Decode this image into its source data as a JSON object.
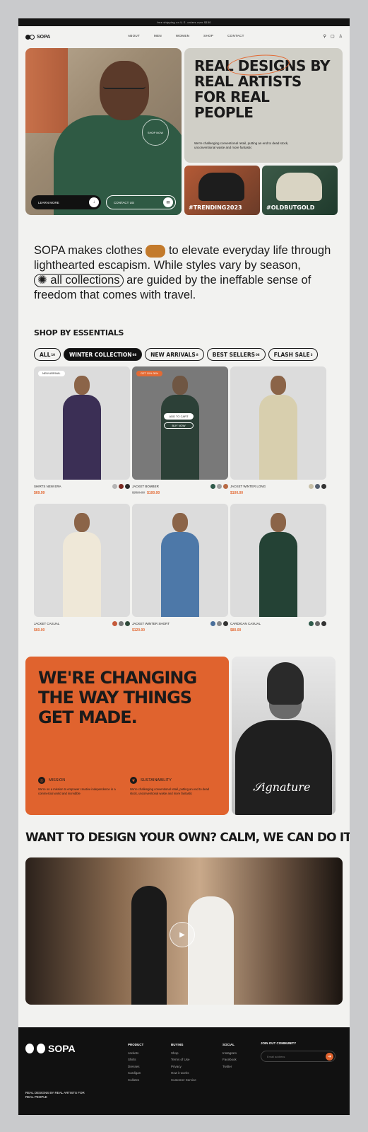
{
  "announcement": "free shipping on U.S. orders over $150",
  "brand": "SOPA",
  "nav": {
    "items": [
      "ABOUT",
      "MEN",
      "WOMEN",
      "SHOP",
      "CONTACT"
    ]
  },
  "hero": {
    "headline": "REAL DESIGNS BY REAL ARTISTS FOR REAL PEOPLE",
    "description": "We're challenging conventional retail, putting an end to dead stock, unconventional waste and more fantastic",
    "shop_now": "SHOP NOW",
    "learn_more": "LEARN MORE",
    "contact_us": "CONTACT US",
    "tiles": [
      "#TRENDING2023",
      "#OLDBUTGOLD"
    ]
  },
  "intro": {
    "part1": "SOPA makes clothes",
    "part2": "to elevate everyday life through lighthearted escapism. While styles vary by season,",
    "collections_pill": "all collections",
    "part3": "are guided by the ineffable sense of freedom that comes with travel."
  },
  "essentials": {
    "title": "SHOP BY ESSENTIALS",
    "filters": [
      {
        "label": "ALL",
        "count": "10"
      },
      {
        "label": "WINTER COLLECTION",
        "count": "08"
      },
      {
        "label": "NEW ARRIVALS",
        "count": "8"
      },
      {
        "label": "BEST SELLERS",
        "count": "06"
      },
      {
        "label": "FLASH SALE",
        "count": "3"
      }
    ],
    "products": [
      {
        "name": "SHIRTS NEW ERA",
        "price": "$69.99",
        "old_price": "",
        "tag": "NEW ARRIVAL",
        "colors": [
          "#b5b5b5",
          "#7a2a22",
          "#2b2b2b"
        ]
      },
      {
        "name": "JACKET BOMBER",
        "price": "$100.00",
        "old_price": "$250.00",
        "tag": "GET 10% 30%",
        "colors": [
          "#2f5a4a",
          "#a0a0a0",
          "#b86a45"
        ],
        "add_to_cart": "ADD TO CART",
        "buy_now": "BUY NOW"
      },
      {
        "name": "JACKET WINTER LONG",
        "price": "$100.00",
        "old_price": "",
        "tag": "",
        "colors": [
          "#c9c1a8",
          "#556070",
          "#333333"
        ]
      },
      {
        "name": "JACKET CASUAL",
        "price": "$60.00",
        "old_price": "",
        "tag": "",
        "colors": [
          "#c55a3a",
          "#777777",
          "#2f4a3a"
        ]
      },
      {
        "name": "JACKET WINTER SHORT",
        "price": "$120.00",
        "old_price": "",
        "tag": "",
        "colors": [
          "#4a6f9a",
          "#888888",
          "#333333"
        ]
      },
      {
        "name": "CARDIGAN CASUAL",
        "price": "$80.00",
        "old_price": "",
        "tag": "",
        "colors": [
          "#2f5a4a",
          "#666666",
          "#333333"
        ]
      }
    ]
  },
  "change": {
    "headline": "WE'RE CHANGING THE WAY THINGS GET MADE.",
    "mission_title": "MISSION",
    "mission_text": "We're on a mission to empower creative independence in a commercial world and incredible",
    "sustain_title": "SUSTAINABILITY",
    "sustain_text": "We're challenging conventional retail, putting an end to dead stock, unconventional waste and more fantastic"
  },
  "design": {
    "headline": "WANT TO DESIGN YOUR OWN? CALM, WE CAN DO IT!"
  },
  "footer": {
    "tagline": "REAL DESIGNS BY REAL ARTISTS FOR REAL PEOPLE",
    "columns": [
      {
        "title": "PRODUCT",
        "links": [
          "Jackets",
          "Shirts",
          "Dresses",
          "Cardigan",
          "Cullotes"
        ]
      },
      {
        "title": "BUYING",
        "links": [
          "Shop",
          "Terms of Use",
          "Privacy",
          "How it works",
          "Customer Service"
        ]
      },
      {
        "title": "SOCIAL",
        "links": [
          "Instagram",
          "Facebook",
          "Twitter"
        ]
      }
    ],
    "join": "JOIN OUT COMMUNITY",
    "email_placeholder": "Email address"
  },
  "colors": {
    "accent": "#e0632e",
    "dark": "#111111",
    "bg": "#f2f2f0"
  }
}
